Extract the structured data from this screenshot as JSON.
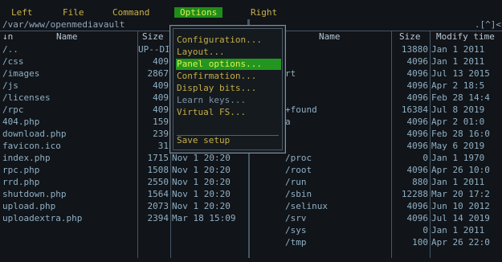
{
  "menu": {
    "left": "Left",
    "file": "File",
    "command": "Command",
    "options": "Options",
    "right": "Right"
  },
  "dropdown": {
    "items": [
      {
        "label": "Configuration..."
      },
      {
        "label": "Layout..."
      },
      {
        "label": "Panel options..."
      },
      {
        "label": "Confirmation..."
      },
      {
        "label": "Display bits..."
      },
      {
        "label": "Learn keys..."
      },
      {
        "label": "Virtual FS..."
      },
      {
        "label": "Save setup"
      }
    ]
  },
  "left_panel": {
    "path": "/var/www/openmediavault",
    "headers": {
      "sort": "↓n",
      "name": "Name",
      "size": "Size"
    },
    "rows": [
      {
        "name": "/..",
        "size": "UP--DI",
        "mtime": ""
      },
      {
        "name": "/css",
        "size": "409",
        "mtime": ""
      },
      {
        "name": "/images",
        "size": "2867",
        "mtime": ""
      },
      {
        "name": "/js",
        "size": "409",
        "mtime": ""
      },
      {
        "name": "/licenses",
        "size": "409",
        "mtime": ""
      },
      {
        "name": "/rpc",
        "size": "409",
        "mtime": ""
      },
      {
        "name": "404.php",
        "size": "159",
        "mtime": ""
      },
      {
        "name": "download.php",
        "size": "239",
        "mtime": ""
      },
      {
        "name": "favicon.ico",
        "size": "31",
        "mtime": ""
      },
      {
        "name": "index.php",
        "size": "1715",
        "mtime": "Nov  1 20:20"
      },
      {
        "name": "rpc.php",
        "size": "1508",
        "mtime": "Nov  1 20:20"
      },
      {
        "name": "rrd.php",
        "size": "2550",
        "mtime": "Nov  1 20:20"
      },
      {
        "name": "shutdown.php",
        "size": "1564",
        "mtime": "Nov  1 20:20"
      },
      {
        "name": "upload.php",
        "size": "2073",
        "mtime": "Nov  1 20:20"
      },
      {
        "name": "uploadextra.php",
        "size": "2394",
        "mtime": "Mar 18 15:09"
      }
    ]
  },
  "right_panel": {
    "indicator": ".[^]<",
    "headers": {
      "name": "Name",
      "size": "Size",
      "mtime": "Modify time"
    },
    "rows": [
      {
        "name": "",
        "size": "13880",
        "mtime": "Jan  1  2011"
      },
      {
        "name": "",
        "size": "4096",
        "mtime": "Jan  1  2011"
      },
      {
        "name": "rt",
        "size": "4096",
        "mtime": "Jul 13  2015"
      },
      {
        "name": "",
        "size": "4096",
        "mtime": "Apr  2 18:5"
      },
      {
        "name": "",
        "size": "4096",
        "mtime": "Feb 28 14:4"
      },
      {
        "name": "+found",
        "size": "16384",
        "mtime": "Jul  8  2019"
      },
      {
        "name": "a",
        "size": "4096",
        "mtime": "Apr  2 01:0"
      },
      {
        "name": "",
        "size": "4096",
        "mtime": "Feb 28 16:0"
      },
      {
        "name": "",
        "size": "4096",
        "mtime": "May  6  2019"
      },
      {
        "name": "/proc",
        "size": "0",
        "mtime": "Jan  1  1970"
      },
      {
        "name": "/root",
        "size": "4096",
        "mtime": "Apr 26 10:0"
      },
      {
        "name": "/run",
        "size": "880",
        "mtime": "Jan  1  2011"
      },
      {
        "name": "/sbin",
        "size": "12288",
        "mtime": "Mar 20 17:2"
      },
      {
        "name": "/selinux",
        "size": "4096",
        "mtime": "Jun 10  2012"
      },
      {
        "name": "/srv",
        "size": "4096",
        "mtime": "Jul 14  2019"
      },
      {
        "name": "/sys",
        "size": "0",
        "mtime": "Jan  1  2011"
      },
      {
        "name": "/tmp",
        "size": "100",
        "mtime": "Apr 26 22:0"
      }
    ]
  }
}
